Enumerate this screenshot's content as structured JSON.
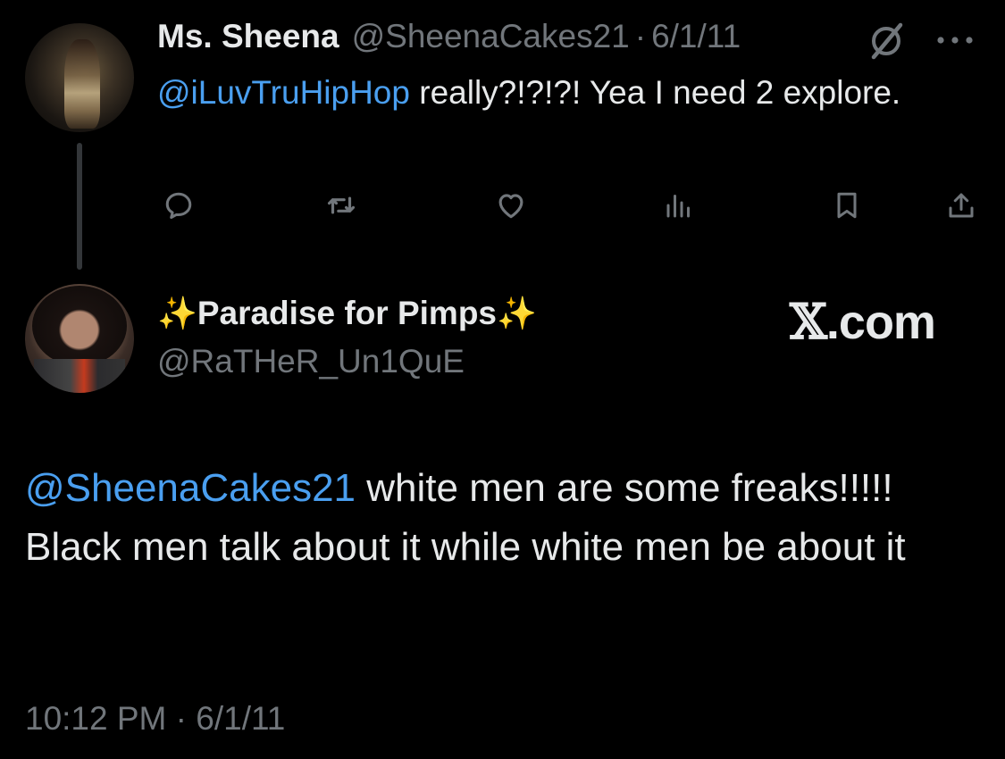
{
  "parent_tweet": {
    "author_name": "Ms. Sheena",
    "author_handle": "@SheenaCakes21",
    "separator": "·",
    "date": "6/1/11",
    "mention": "@iLuvTruHipHop",
    "text": " really?!?!?! Yea I need 2 explore.",
    "icons": {
      "grok": "grok-icon",
      "more": "more-icon"
    },
    "actions": [
      "reply-icon",
      "retweet-icon",
      "like-icon",
      "views-icon",
      "bookmark-icon",
      "share-icon"
    ]
  },
  "main_tweet": {
    "author_name": "Paradise for Pimps",
    "name_emoji": "✨",
    "author_handle": "@RaTHeR_Un1QuE",
    "mention": "@SheenaCakes21",
    "text": " white men are some freaks!!!!! Black men talk about it while white men be about it",
    "time": "10:12 PM",
    "separator": "·",
    "date": "6/1/11"
  },
  "watermark": {
    "mark": "𝕏",
    "text": ".com"
  },
  "colors": {
    "background": "#000000",
    "text": "#e7e9ea",
    "secondary": "#71767b",
    "link": "#4a9ff0"
  }
}
